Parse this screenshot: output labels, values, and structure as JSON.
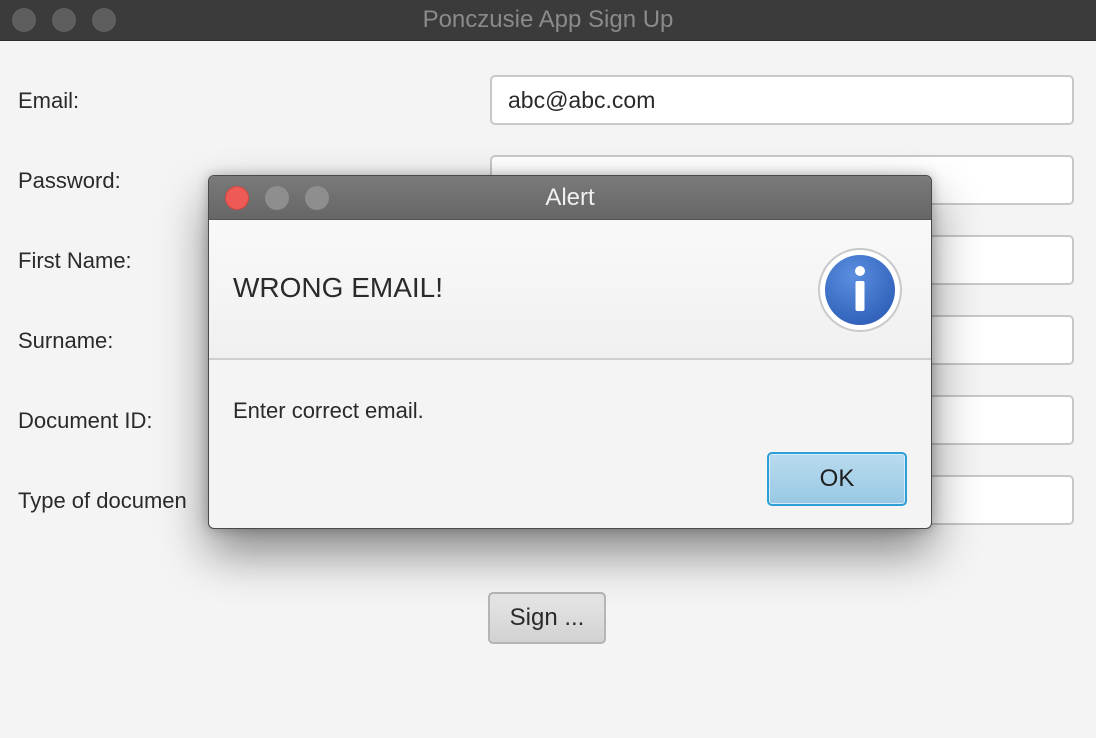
{
  "window": {
    "title": "Ponczusie App Sign Up"
  },
  "form": {
    "email_label": "Email:",
    "email_value": "abc@abc.com",
    "password_label": "Password:",
    "password_value": "●●●",
    "first_name_label": "First Name:",
    "surname_label": "Surname:",
    "document_id_label": "Document ID:",
    "document_type_label": "Type of documen",
    "sign_button": "Sign ..."
  },
  "alert": {
    "title": "Alert",
    "header": "WRONG EMAIL!",
    "content": "Enter correct email.",
    "ok_button": "OK",
    "icon": "info-icon",
    "icon_color": "#3a6fc8"
  },
  "colors": {
    "close_button": "#ee5b57",
    "ok_border": "#2e9fd6"
  }
}
